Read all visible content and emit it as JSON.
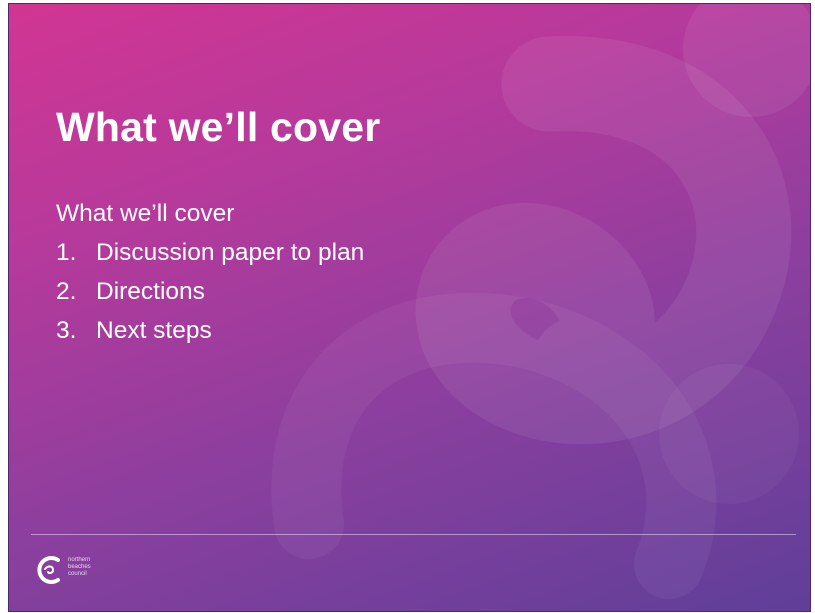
{
  "slide": {
    "title": "What we’ll cover",
    "intro": "What we’ll cover",
    "items": [
      {
        "number": "1.",
        "label": "Discussion paper to plan"
      },
      {
        "number": "2.",
        "label": "Directions"
      },
      {
        "number": "3.",
        "label": "Next steps"
      }
    ]
  },
  "footer": {
    "logo_lines": [
      "northern",
      "beaches",
      "council"
    ],
    "logo_icon": "wave-c-logo-icon"
  },
  "colors": {
    "gradient_top": "#d23592",
    "gradient_bottom": "#5f3f99",
    "text": "#ffffff"
  }
}
